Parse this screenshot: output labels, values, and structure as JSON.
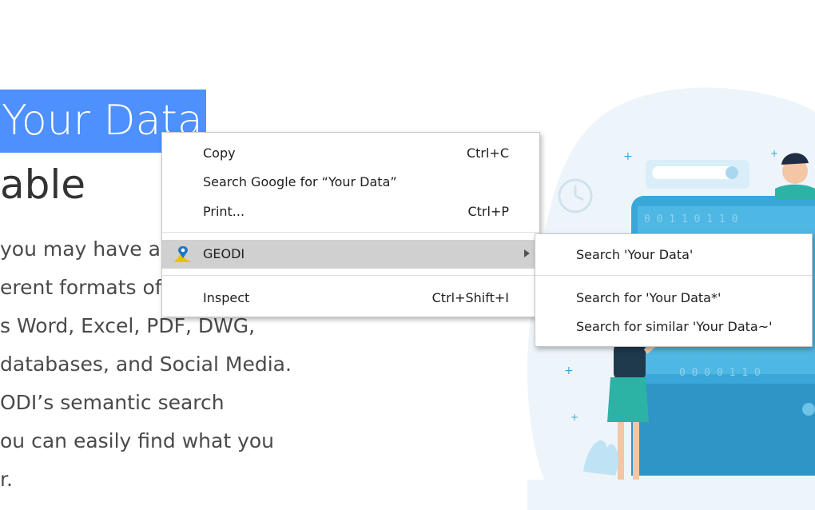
{
  "page": {
    "title_selected": "Your Data",
    "title_line2": "able",
    "paragraph_lines": [
      "you may have a",
      "erent formats of",
      "s Word, Excel, PDF, DWG,",
      "databases, and Social Media.",
      "ODI’s semantic search",
      "ou can easily find what you",
      "r."
    ]
  },
  "illustration": {
    "screen_binary_1": "0  0 1 1 0 1 1 0",
    "screen_binary_2": "0 0 0 0 1 1 0"
  },
  "context_menu": {
    "items": [
      {
        "label": "Copy",
        "shortcut": "Ctrl+C"
      },
      {
        "label": "Search Google for “Your Data”",
        "shortcut": ""
      },
      {
        "label": "Print...",
        "shortcut": "Ctrl+P"
      },
      {
        "label": "GEODI",
        "shortcut": ""
      },
      {
        "label": "Inspect",
        "shortcut": "Ctrl+Shift+I"
      }
    ]
  },
  "submenu": {
    "items": [
      {
        "label": "Search 'Your Data'"
      },
      {
        "label": "Search for 'Your Data*'"
      },
      {
        "label": "Search for similar 'Your Data~'"
      }
    ]
  },
  "colors": {
    "selection": "#4d90fe",
    "highlight": "#d0d0d0",
    "illustration_blue": "#39a7d9"
  }
}
